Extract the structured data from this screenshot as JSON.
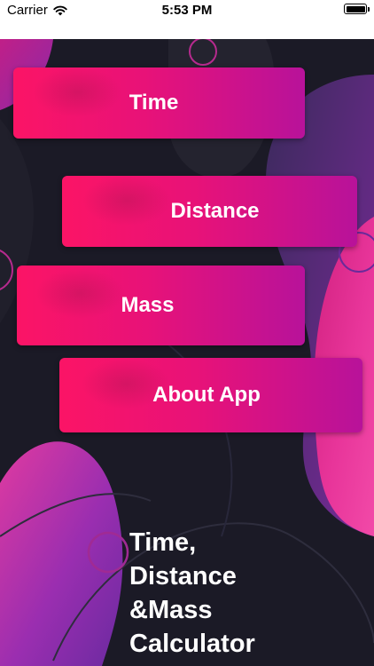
{
  "status_bar": {
    "carrier": "Carrier",
    "time": "5:53 PM",
    "wifi_icon": "wifi-icon",
    "battery_icon": "battery-icon"
  },
  "menu": {
    "items": [
      {
        "label": "Time"
      },
      {
        "label": "Distance"
      },
      {
        "label": "Mass"
      },
      {
        "label": "About App"
      }
    ]
  },
  "title": {
    "lines": [
      "Time,",
      "Distance",
      "&Mass",
      "Calculator"
    ]
  },
  "colors": {
    "background": "#1b1a26",
    "button_start": "#fb1466",
    "button_end": "#b8129a",
    "accent_pink": "#e0308e",
    "accent_purple": "#7a2aa0",
    "text": "#ffffff"
  }
}
